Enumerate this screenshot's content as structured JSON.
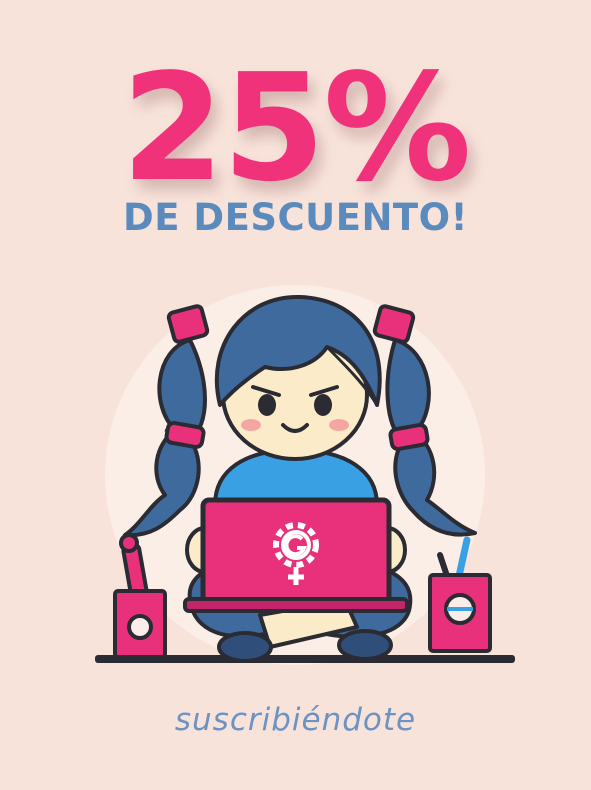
{
  "promo": {
    "discount": "25%",
    "subtitle": "DE DESCUENTO!",
    "footer": "suscribiéndote"
  },
  "illustration": {
    "subject": "girl with pigtails using laptop",
    "laptop_logo_icon": "gear-g-venus-icon",
    "props": [
      "pen-holder-icon",
      "pencil-cup-icon"
    ]
  },
  "colors": {
    "background": "#f8e3db",
    "accent_pink": "#f0327a",
    "accent_blue": "#5b8bbd",
    "hair_blue": "#3f6a9e",
    "shirt_blue": "#3aa0e4",
    "outline": "#2b2b33"
  }
}
